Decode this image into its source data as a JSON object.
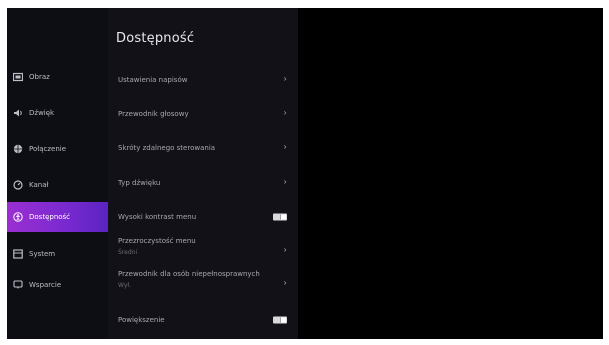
{
  "nav": {
    "items": [
      {
        "label": "Obraz",
        "icon": "picture-icon",
        "active": false
      },
      {
        "label": "Dźwięk",
        "icon": "speaker-icon",
        "active": false
      },
      {
        "label": "Połączenie",
        "icon": "globe-icon",
        "active": false
      },
      {
        "label": "Kanał",
        "icon": "channel-icon",
        "active": false
      },
      {
        "label": "Dostępność",
        "icon": "accessibility-icon",
        "active": true
      },
      {
        "label": "System",
        "icon": "system-icon",
        "active": false
      },
      {
        "label": "Wsparcie",
        "icon": "support-icon",
        "active": false
      }
    ]
  },
  "panel": {
    "title": "Dostępność",
    "items": [
      {
        "label": "Ustawienia napisów",
        "control": "chevron"
      },
      {
        "label": "Przewodnik głosowy",
        "control": "chevron"
      },
      {
        "label": "Skróty zdalnego sterowania",
        "control": "chevron"
      },
      {
        "label": "Typ dźwięku",
        "control": "chevron"
      },
      {
        "label": "Wysoki kontrast menu",
        "control": "toggle",
        "value": "off"
      },
      {
        "label": "Przezroczystość menu",
        "sub": "Średni",
        "control": "chevron"
      },
      {
        "label": "Przewodnik dla osób niepełnosprawnych",
        "sub": "Wył.",
        "control": "chevron"
      },
      {
        "label": "Powiększenie",
        "control": "toggle",
        "value": "off"
      }
    ]
  },
  "colors": {
    "accent_start": "#9a2fd1",
    "accent_end": "#5a24c2",
    "background": "#000000"
  }
}
